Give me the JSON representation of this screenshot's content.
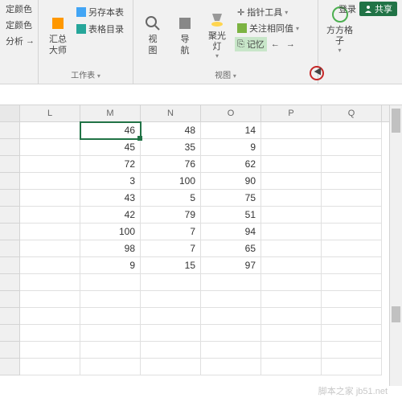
{
  "top": {
    "login": "登录",
    "share": "共享"
  },
  "ribbon": {
    "g1": {
      "items": [
        "定颜色",
        "定颜色",
        "分析"
      ],
      "arrow": "→"
    },
    "g2": {
      "big": "汇总\n大师",
      "items": [
        "另存本表",
        "表格目录"
      ],
      "label": "工作表",
      "dd": "▾"
    },
    "g3": {
      "btns": [
        "视\n图",
        "导\n航",
        "聚光\n灯"
      ],
      "row": [
        "指针工具",
        "关注相同值",
        "记忆",
        "←",
        "→"
      ],
      "label": "视图",
      "dd": "▾"
    },
    "g4": {
      "big": "方方格\n子",
      "dd": "▾"
    }
  },
  "grid": {
    "cols": [
      "L",
      "M",
      "N",
      "O",
      "P",
      "Q"
    ],
    "data": [
      {
        "M": "46",
        "N": "48",
        "O": "14"
      },
      {
        "M": "45",
        "N": "35",
        "O": "9"
      },
      {
        "M": "72",
        "N": "76",
        "O": "62"
      },
      {
        "M": "3",
        "N": "100",
        "O": "90"
      },
      {
        "M": "43",
        "N": "5",
        "O": "75"
      },
      {
        "M": "42",
        "N": "79",
        "O": "51"
      },
      {
        "M": "100",
        "N": "7",
        "O": "94"
      },
      {
        "M": "98",
        "N": "7",
        "O": "65"
      },
      {
        "M": "9",
        "N": "15",
        "O": "97"
      }
    ],
    "selected": {
      "row": 0,
      "col": "M"
    },
    "emptyRows": 6
  },
  "watermark": "脚本之家 jb51.net"
}
